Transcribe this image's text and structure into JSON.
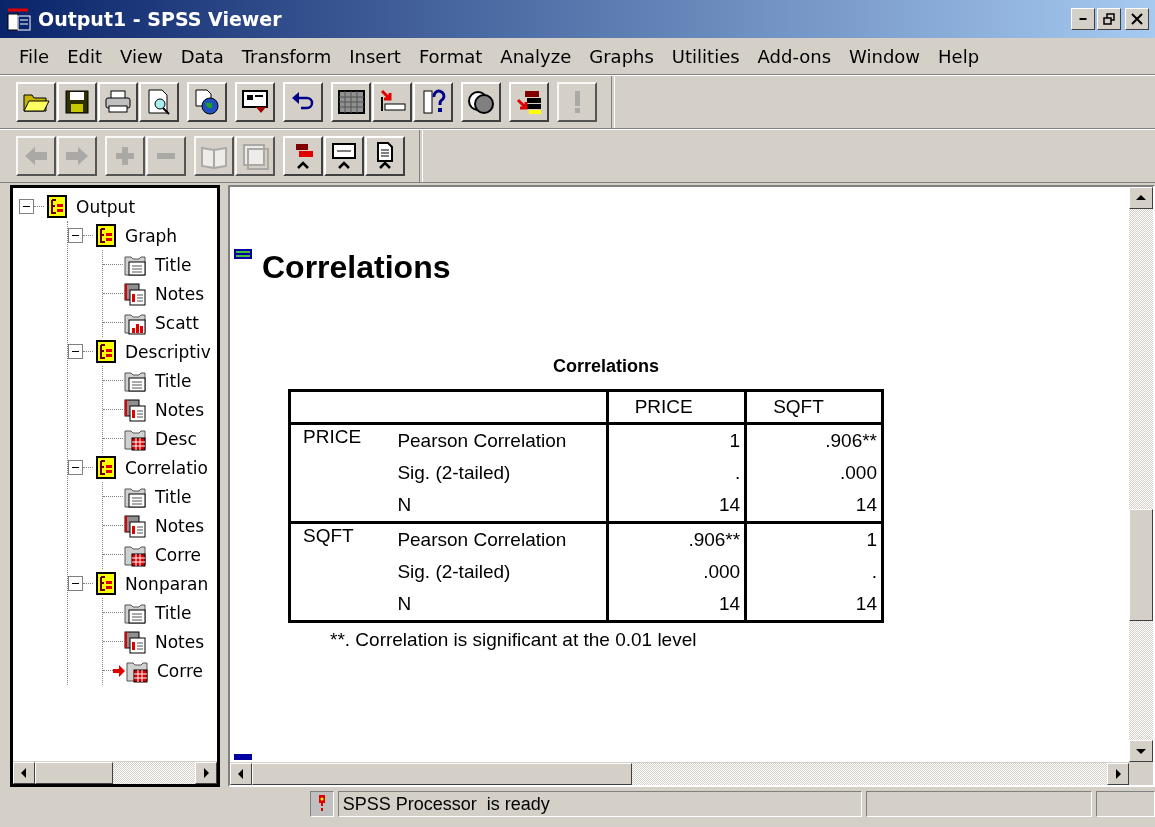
{
  "window": {
    "title": "Output1 - SPSS Viewer"
  },
  "menu": [
    "File",
    "Edit",
    "View",
    "Data",
    "Transform",
    "Insert",
    "Format",
    "Analyze",
    "Graphs",
    "Utilities",
    "Add-ons",
    "Window",
    "Help"
  ],
  "toolbars": [
    {
      "groups": [
        {
          "buttons": [
            {
              "kind": "open",
              "disabled": false
            },
            {
              "kind": "save",
              "disabled": false
            },
            {
              "kind": "print",
              "disabled": false
            },
            {
              "kind": "preview",
              "disabled": false
            }
          ]
        },
        {
          "buttons": [
            {
              "kind": "globe",
              "disabled": false
            }
          ]
        },
        {
          "buttons": [
            {
              "kind": "dialog",
              "disabled": false
            }
          ]
        },
        {
          "buttons": [
            {
              "kind": "undo",
              "disabled": false
            }
          ]
        },
        {
          "buttons": [
            {
              "kind": "grid",
              "disabled": false
            },
            {
              "kind": "gotocase",
              "disabled": false
            },
            {
              "kind": "variables",
              "disabled": false
            }
          ]
        },
        {
          "buttons": [
            {
              "kind": "circles",
              "disabled": false
            }
          ]
        },
        {
          "buttons": [
            {
              "kind": "designate",
              "disabled": false
            }
          ]
        },
        {
          "buttons": [
            {
              "kind": "run",
              "disabled": true
            }
          ]
        }
      ]
    },
    {
      "groups": [
        {
          "buttons": [
            {
              "kind": "back",
              "disabled": true
            },
            {
              "kind": "forward",
              "disabled": true
            }
          ]
        },
        {
          "buttons": [
            {
              "kind": "plus",
              "disabled": true
            },
            {
              "kind": "minus",
              "disabled": true
            }
          ]
        },
        {
          "buttons": [
            {
              "kind": "book",
              "disabled": true
            },
            {
              "kind": "page",
              "disabled": true
            }
          ]
        },
        {
          "buttons": [
            {
              "kind": "heading",
              "disabled": false
            },
            {
              "kind": "chartitem",
              "disabled": false
            },
            {
              "kind": "docitem",
              "disabled": false
            }
          ]
        }
      ]
    }
  ],
  "outline": [
    {
      "label": "Output",
      "kind": "book",
      "expanded": true,
      "children": [
        {
          "label": "Graph",
          "kind": "book",
          "expanded": true,
          "children": [
            {
              "label": "Title",
              "kind": "title",
              "current": false
            },
            {
              "label": "Notes",
              "kind": "notes",
              "current": false
            },
            {
              "label": "Scatt",
              "kind": "chart",
              "current": false
            }
          ]
        },
        {
          "label": "Descriptiv",
          "kind": "book",
          "expanded": true,
          "children": [
            {
              "label": "Title",
              "kind": "title",
              "current": false
            },
            {
              "label": "Notes",
              "kind": "notes",
              "current": false
            },
            {
              "label": "Desc",
              "kind": "table",
              "current": false
            }
          ]
        },
        {
          "label": "Correlatio",
          "kind": "book",
          "expanded": true,
          "children": [
            {
              "label": "Title",
              "kind": "title",
              "current": false
            },
            {
              "label": "Notes",
              "kind": "notes",
              "current": false
            },
            {
              "label": "Corre",
              "kind": "table",
              "current": false
            }
          ]
        },
        {
          "label": "Nonparan",
          "kind": "book",
          "expanded": true,
          "children": [
            {
              "label": "Title",
              "kind": "title",
              "current": false
            },
            {
              "label": "Notes",
              "kind": "notes",
              "current": false
            },
            {
              "label": "Corre",
              "kind": "table",
              "current": true
            }
          ]
        }
      ]
    }
  ],
  "output": {
    "heading": "Correlations",
    "table": {
      "title": "Correlations",
      "columns": [
        "PRICE",
        "SQFT"
      ],
      "groups": [
        {
          "variable": "PRICE",
          "rows": [
            {
              "statistic": "Pearson Correlation",
              "values": [
                "1",
                ".906**"
              ]
            },
            {
              "statistic": "Sig. (2-tailed)",
              "values": [
                ".",
                ".000"
              ]
            },
            {
              "statistic": "N",
              "values": [
                "14",
                "14"
              ]
            }
          ]
        },
        {
          "variable": "SQFT",
          "rows": [
            {
              "statistic": "Pearson Correlation",
              "values": [
                ".906**",
                "1"
              ]
            },
            {
              "statistic": "Sig. (2-tailed)",
              "values": [
                ".000",
                "."
              ]
            },
            {
              "statistic": "N",
              "values": [
                "14",
                "14"
              ]
            }
          ]
        }
      ],
      "footnote": "**. Correlation is significant at the 0.01 level"
    }
  },
  "status_bar": {
    "message": "SPSS Processor  is ready"
  }
}
